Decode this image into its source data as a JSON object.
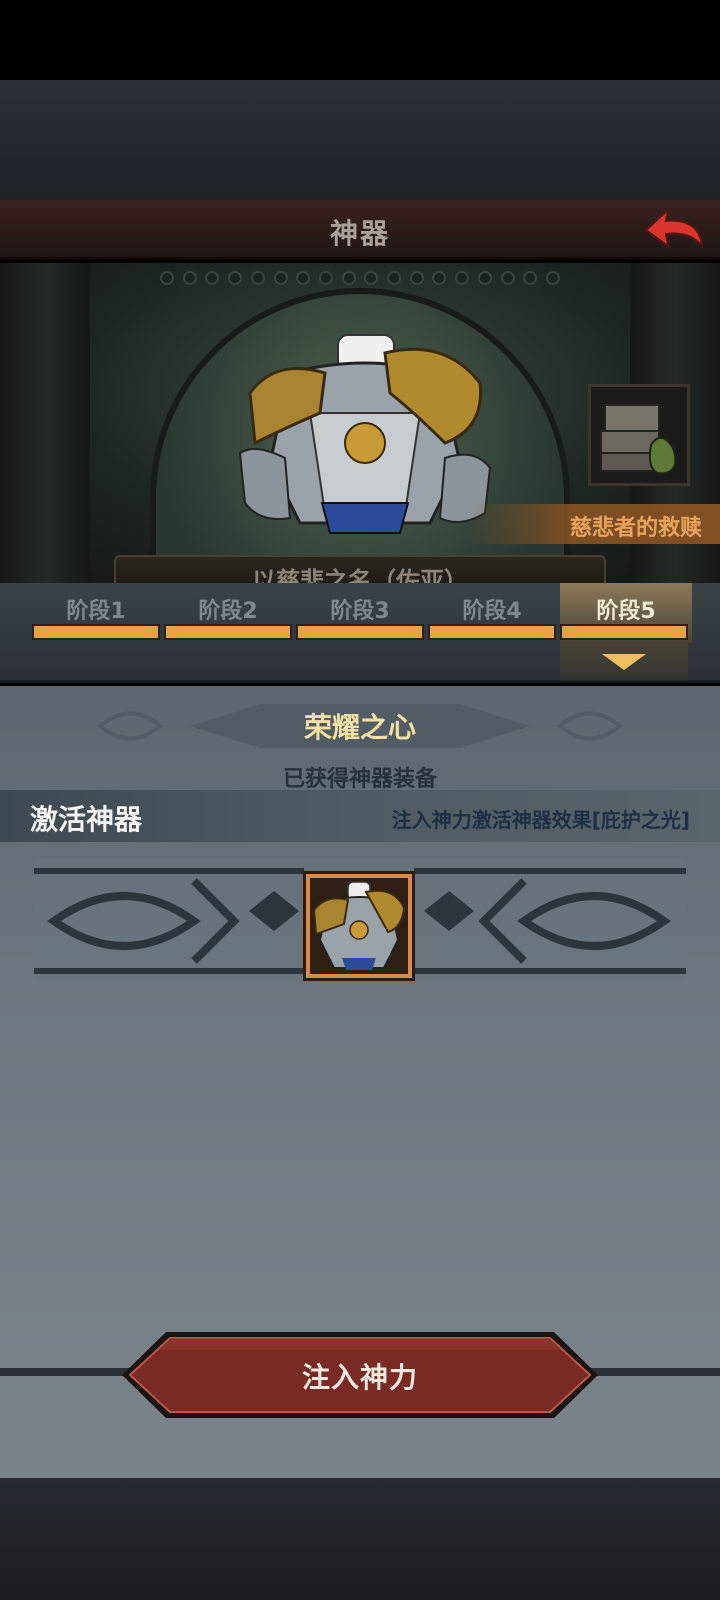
{
  "header": {
    "title": "神器",
    "back_icon": "back-arrow-icon"
  },
  "artifact": {
    "name": "慈悲者的救赎",
    "hidden_banner": "以慈悲之名（佐亚）",
    "treasure_icon": "treasure-chest-icon"
  },
  "stages": {
    "items": [
      {
        "label": "阶段1"
      },
      {
        "label": "阶段2"
      },
      {
        "label": "阶段3"
      },
      {
        "label": "阶段4"
      },
      {
        "label": "阶段5"
      }
    ],
    "active_index": 4
  },
  "panel": {
    "title": "荣耀之心",
    "subtitle": "已获得神器装备",
    "activate_label": "激活神器",
    "activate_desc": "注入神力激活神器效果[庇护之光]"
  },
  "action": {
    "inject_label": "注入神力"
  },
  "colors": {
    "accent_gold": "#e8a443",
    "title_gold": "#f2e1a2",
    "back_red": "#d8352c",
    "button_red": "#7a2a24",
    "orange_tag": "#e9a45c"
  }
}
